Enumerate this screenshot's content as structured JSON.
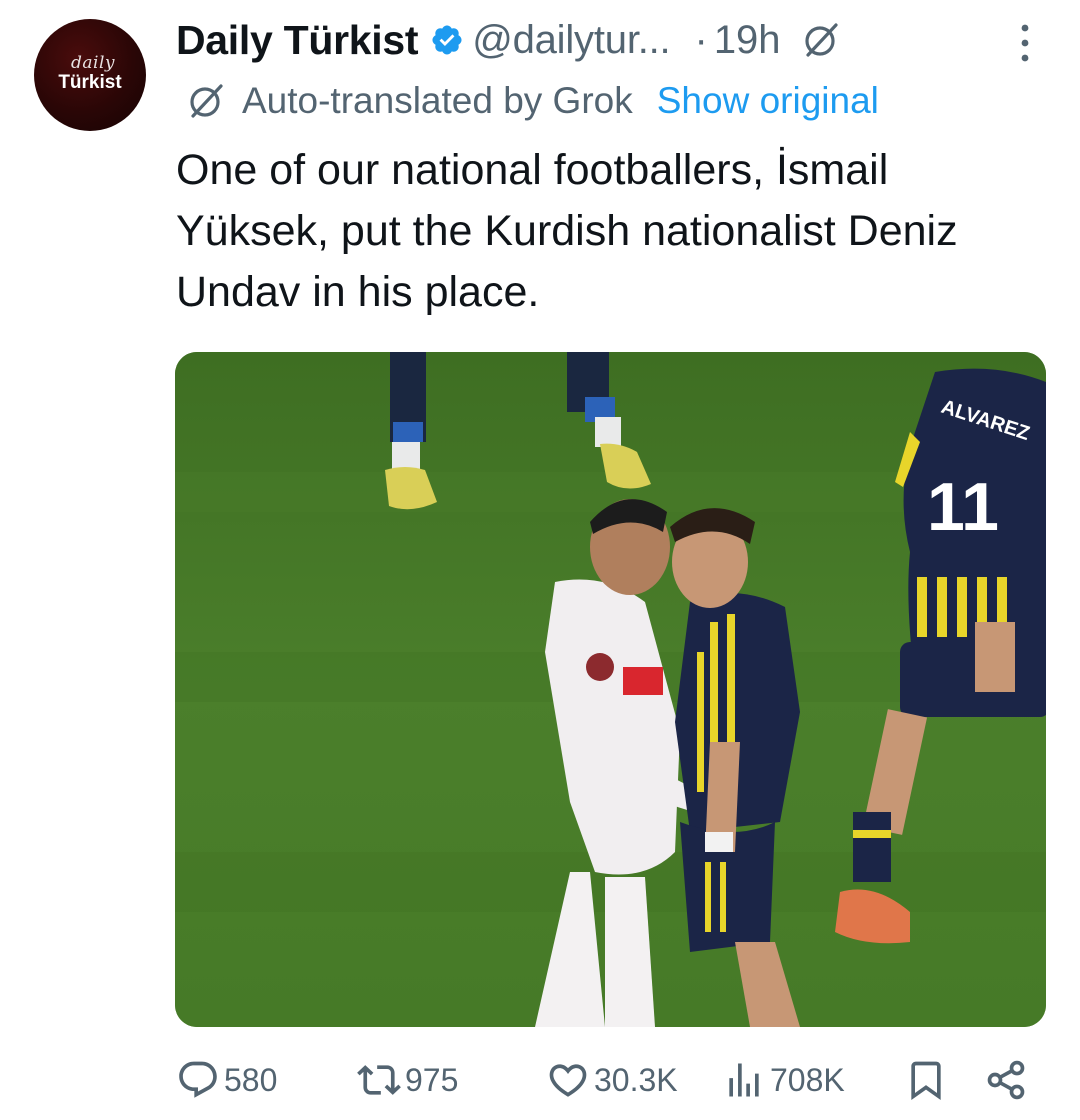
{
  "avatar": {
    "line1": "daily",
    "line2": "Türkist"
  },
  "header": {
    "display_name": "Daily Türkist",
    "handle": "@dailytur...",
    "separator": "·",
    "time": "19h",
    "verified_color": "#1d9bf0"
  },
  "translation": {
    "label": "Auto-translated by Grok",
    "show_original": "Show original"
  },
  "tweet": {
    "text": "One of our national footballers, İsmail\nYüksek, put the Kurdish nationalist Deniz\nUndav in his place."
  },
  "media": {
    "jersey_name": "ALVAREZ",
    "jersey_number": "11"
  },
  "actions": {
    "replies": "580",
    "reposts": "975",
    "likes": "30.3K",
    "views": "708K"
  },
  "icons": [
    "verified-badge-icon",
    "grok-icon",
    "more-icon",
    "reply-icon",
    "repost-icon",
    "like-icon",
    "views-icon",
    "bookmark-icon",
    "share-icon"
  ],
  "colors": {
    "accent": "#1d9bf0",
    "muted": "#536471",
    "text": "#0f1419"
  }
}
